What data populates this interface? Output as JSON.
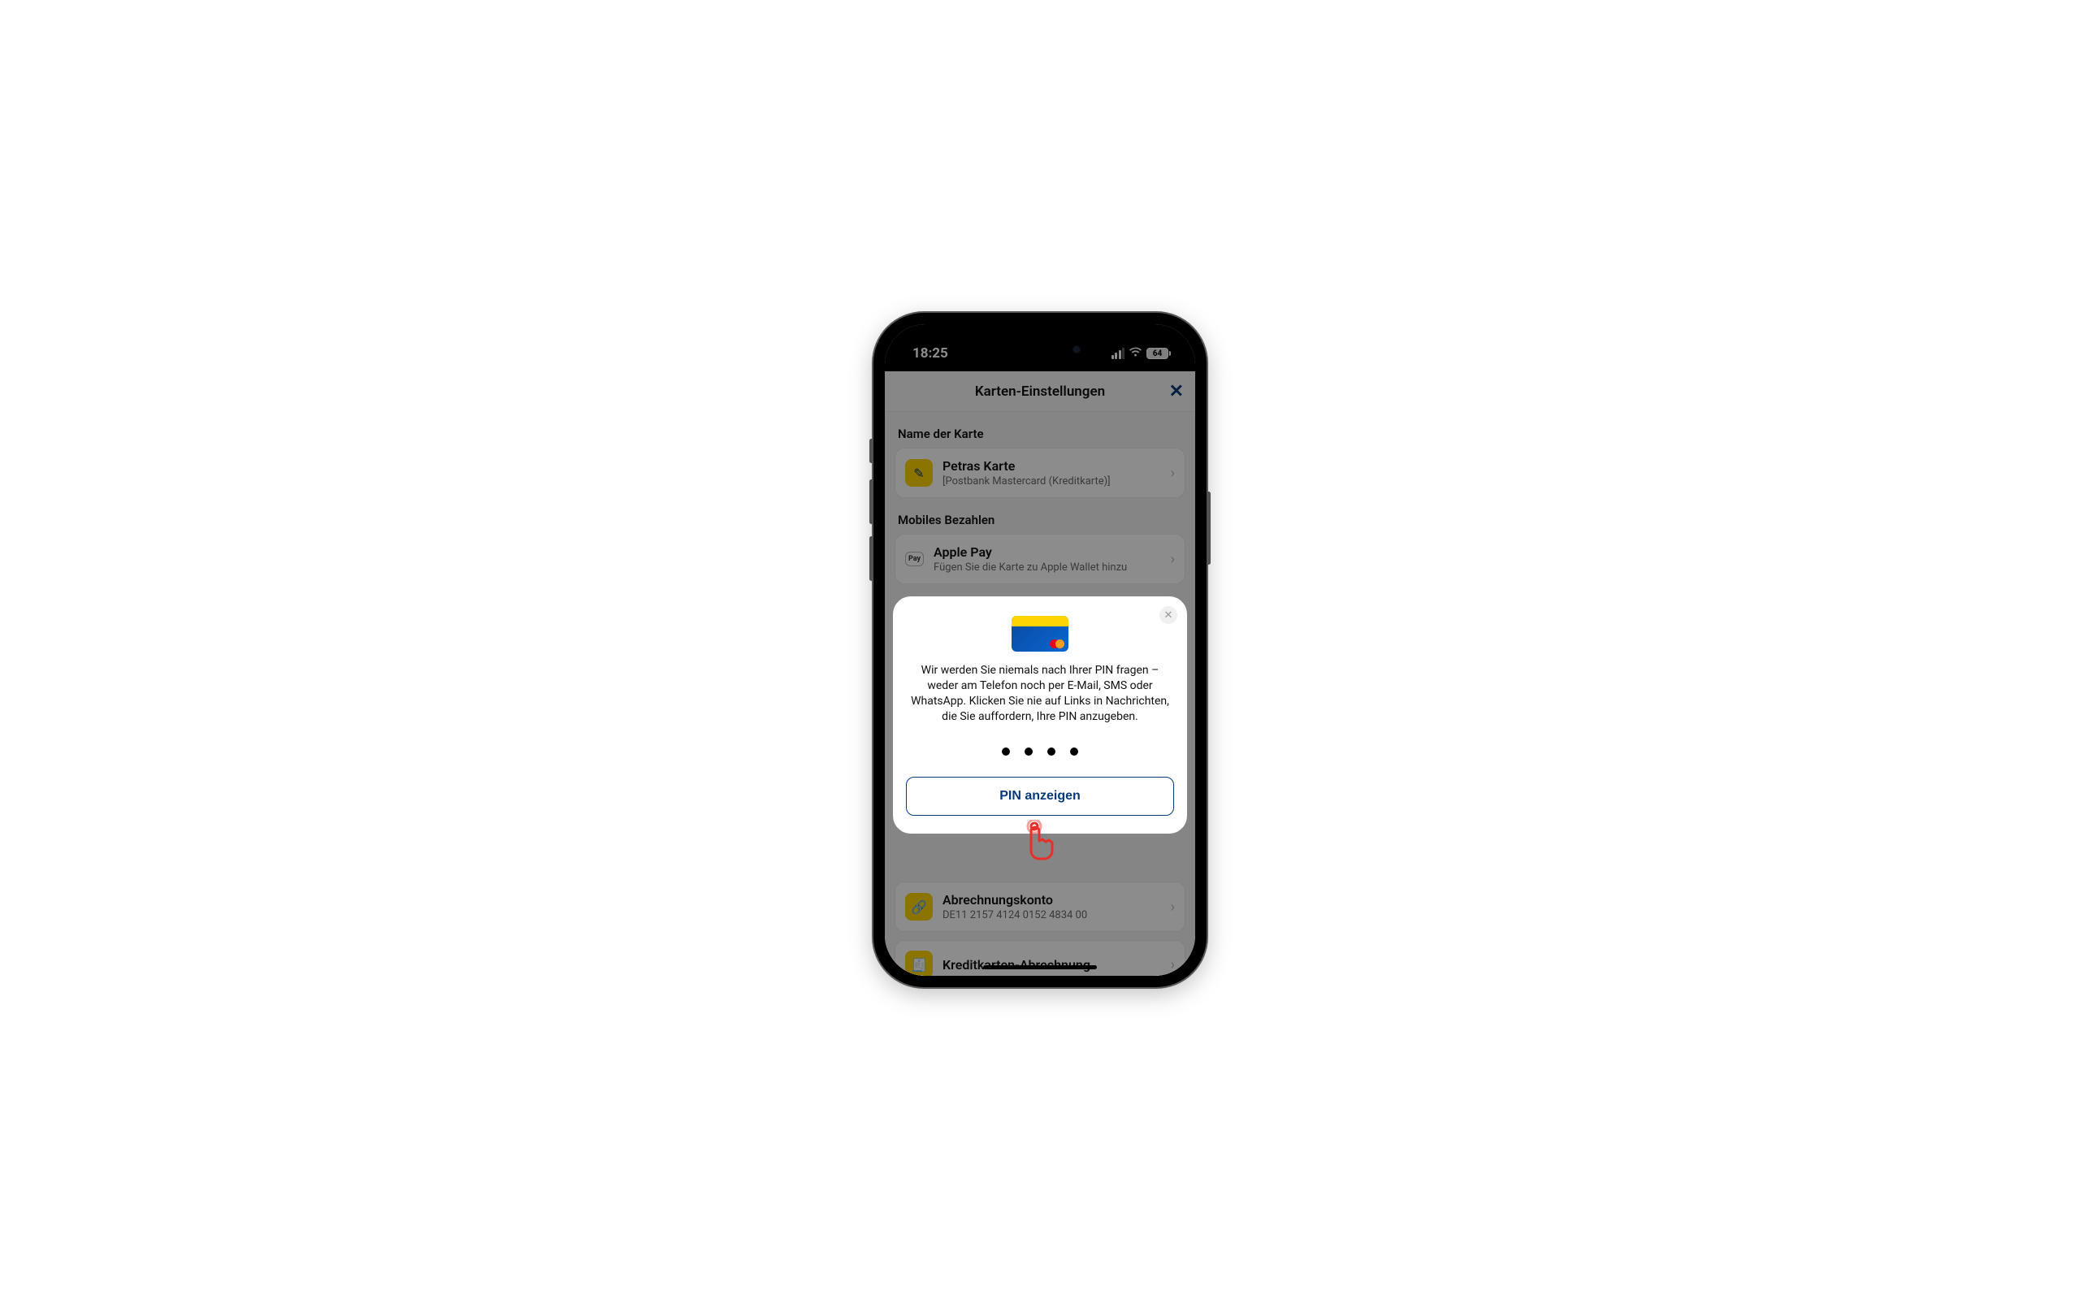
{
  "statusbar": {
    "time": "18:25",
    "battery": "64"
  },
  "header": {
    "title": "Karten-Einstellungen"
  },
  "sections": {
    "cardname": {
      "heading": "Name der Karte",
      "item": {
        "title": "Petras Karte",
        "subtitle": "[Postbank Mastercard (Kreditkarte)]"
      }
    },
    "mobilepay": {
      "heading": "Mobiles Bezahlen",
      "item": {
        "title": "Apple Pay",
        "subtitle": "Fügen Sie die Karte zu Apple Wallet hinzu",
        "icon_label": "Pay"
      }
    },
    "billing": {
      "item": {
        "title": "Abrechnungskonto",
        "subtitle": "DE11 2157 4124 0152 4834 00"
      }
    },
    "statement": {
      "item": {
        "title": "Kreditkarten-Abrechnung"
      }
    }
  },
  "modal": {
    "message": "Wir werden Sie niemals nach Ihrer PIN fragen – weder am Telefon noch per E-Mail, SMS oder WhatsApp. Klicken Sie nie auf Links in Nachrichten, die Sie auffordern, Ihre PIN anzugeben.",
    "button": "PIN anzeigen"
  }
}
